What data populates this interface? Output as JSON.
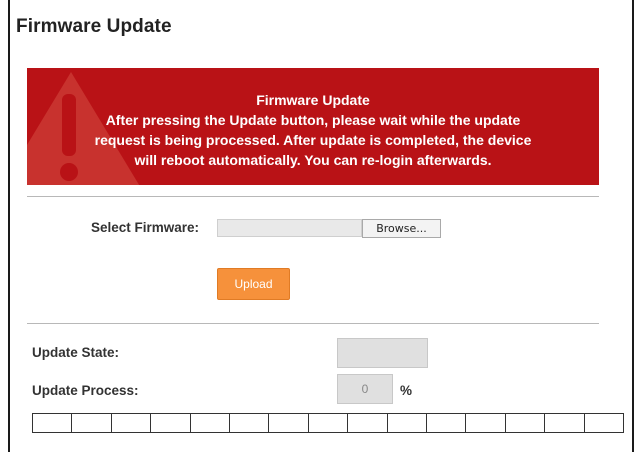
{
  "page": {
    "title": "Firmware Update"
  },
  "warning": {
    "heading": "Firmware Update",
    "lines": [
      "After pressing the Update button, please wait while the update",
      "request is being processed. After update is completed, the device",
      "will reboot automatically. You can re-login afterwards."
    ],
    "color": "#b91216"
  },
  "firmware": {
    "select_label": "Select Firmware:",
    "file_value": "",
    "browse_label": "Browse...",
    "upload_label": "Upload"
  },
  "status": {
    "state_label": "Update State:",
    "state_value": "",
    "process_label": "Update Process:",
    "process_value": "0",
    "percent_sign": "%",
    "progress_fraction": 0,
    "progress_segments": 15
  },
  "colors": {
    "accent": "#f6913b",
    "banner": "#b91216"
  }
}
